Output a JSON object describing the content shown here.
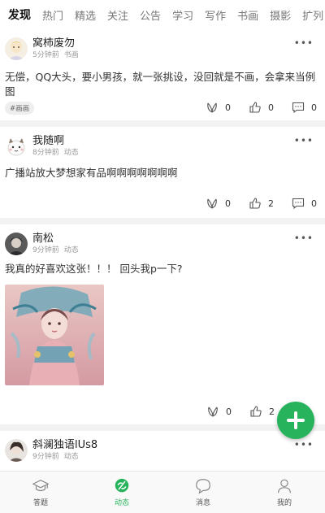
{
  "tabs": [
    "发现",
    "热门",
    "精选",
    "关注",
    "公告",
    "学习",
    "写作",
    "书画",
    "摄影",
    "扩列"
  ],
  "posts": [
    {
      "author": "窝柿废勿",
      "time": "5分钟前",
      "category": "书画",
      "text": "无偿，QQ大头，要小男孩，就一张挑设，没回就是不画，会拿来当例图",
      "tag": "#画画",
      "likes_a": "0",
      "likes_b": "0",
      "comments": "0"
    },
    {
      "author": "我随啊",
      "time": "8分钟前",
      "category": "动态",
      "text": "广播站放大梦想家有品啊啊啊啊啊啊啊",
      "likes_a": "0",
      "likes_b": "2",
      "comments": "0"
    },
    {
      "author": "南松",
      "time": "9分钟前",
      "category": "动态",
      "text": "我真的好喜欢这张！！！ 回头我p一下?",
      "likes_a": "0",
      "likes_b": "2"
    },
    {
      "author": "斜澜独语lUs8",
      "time": "9分钟前",
      "category": "动态"
    }
  ],
  "more_label": "•••",
  "nav": [
    "答题",
    "动态",
    "消息",
    "我的"
  ],
  "colors": {
    "accent": "#27b35c",
    "background": "#f2f2f2"
  },
  "icons": [
    "hands-icon",
    "thumbs-up-icon",
    "comment-icon",
    "plus-icon",
    "grad-cap-icon",
    "dynamic-icon",
    "message-icon",
    "person-icon"
  ]
}
